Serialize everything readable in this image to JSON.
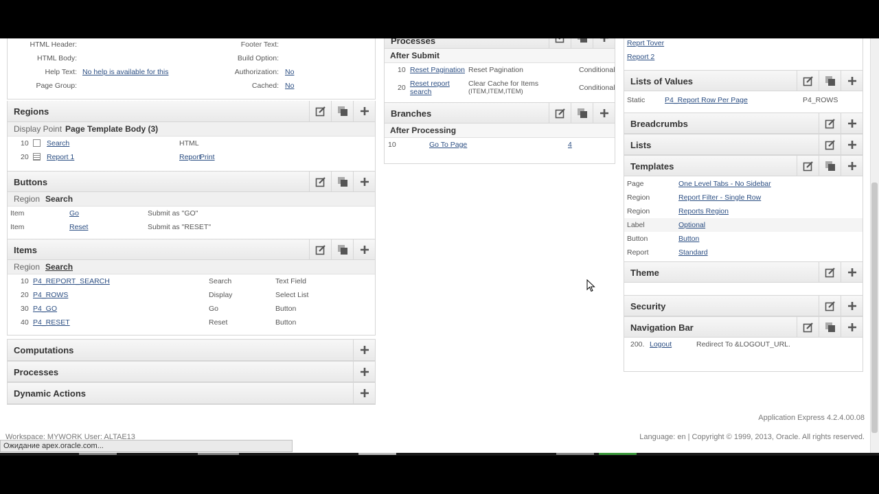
{
  "page_props": {
    "html_header_label": "HTML Header:",
    "html_body_label": "HTML Body:",
    "help_text_label": "Help Text:",
    "help_text_value": "No help is available for this",
    "page_group_label": "Page Group:",
    "footer_text_label": "Footer Text:",
    "build_option_label": "Build Option:",
    "authorization_label": "Authorization:",
    "authorization_value": "No",
    "cached_label": "Cached:",
    "cached_value": "No"
  },
  "regions": {
    "title": "Regions",
    "display_point_label": "Display Point",
    "display_point_value": "Page Template Body (3)",
    "rows": [
      {
        "seq": "10",
        "name": "Search",
        "type": "HTML",
        "extra1": "",
        "extra2": ""
      },
      {
        "seq": "20",
        "name": "Report 1",
        "type": "",
        "extra1": "Report",
        "extra2": "Print"
      }
    ]
  },
  "buttons": {
    "title": "Buttons",
    "region_label": "Region",
    "region_value": "Search",
    "rows": [
      {
        "kind": "Item",
        "name": "Go",
        "action": "Submit as \"GO\""
      },
      {
        "kind": "Item",
        "name": "Reset",
        "action": "Submit as \"RESET\""
      }
    ]
  },
  "items": {
    "title": "Items",
    "region_label": "Region",
    "region_value": "Search",
    "rows": [
      {
        "seq": "10",
        "name": "P4_REPORT_SEARCH",
        "label": "Search",
        "type": "Text Field"
      },
      {
        "seq": "20",
        "name": "P4_ROWS",
        "label": "Display",
        "type": "Select List"
      },
      {
        "seq": "30",
        "name": "P4_GO",
        "label": "Go",
        "type": "Button"
      },
      {
        "seq": "40",
        "name": "P4_RESET",
        "label": "Reset",
        "type": "Button"
      }
    ]
  },
  "left_bottom": {
    "computations": "Computations",
    "processes": "Processes",
    "dynamic_actions": "Dynamic Actions"
  },
  "middle": {
    "processes_title": "Processes",
    "after_submit": "After Submit",
    "process_rows": [
      {
        "seq": "10",
        "name": "Reset Pagination",
        "name2": "",
        "desc": "Reset Pagination",
        "desc2": "",
        "cond": "Conditional"
      },
      {
        "seq": "20",
        "name": "Reset report",
        "name2": "search",
        "desc": "Clear Cache for Items",
        "desc2": "(ITEM,ITEM,ITEM)",
        "cond": "Conditional"
      }
    ],
    "branches_title": "Branches",
    "after_processing": "After Processing",
    "branch_row": {
      "seq": "10",
      "name": "Go To Page",
      "target": "4"
    }
  },
  "right": {
    "shared_links": [
      "Reprt Tover",
      "Report 2"
    ],
    "lov_title": "Lists of Values",
    "lov_row": {
      "kind": "Static",
      "name": "P4_Report Row Per Page",
      "item": "P4_ROWS"
    },
    "breadcrumbs_title": "Breadcrumbs",
    "lists_title": "Lists",
    "templates_title": "Templates",
    "template_rows": [
      {
        "kind": "Page",
        "value": "One Level Tabs - No Sidebar"
      },
      {
        "kind": "Region",
        "value": "Report Filter - Single Row"
      },
      {
        "kind": "Region",
        "value": "Reports Region"
      },
      {
        "kind": "Label",
        "value": "Optional"
      },
      {
        "kind": "Button",
        "value": "Button"
      },
      {
        "kind": "Report",
        "value": "Standard"
      }
    ],
    "theme_title": "Theme",
    "security_title": "Security",
    "navbar_title": "Navigation Bar",
    "navbar_row": {
      "seq": "200.",
      "name": "Logout",
      "target": "Redirect To &LOGOUT_URL."
    }
  },
  "footer": {
    "version": "Application Express 4.2.4.00.08",
    "workspace": "Workspace: MYWORK User: ALTAE13",
    "copyright": "Language: en | Copyright © 1999, 2013, Oracle. All rights reserved."
  },
  "statusbar": {
    "text": "Ожидание apex.oracle.com..."
  }
}
